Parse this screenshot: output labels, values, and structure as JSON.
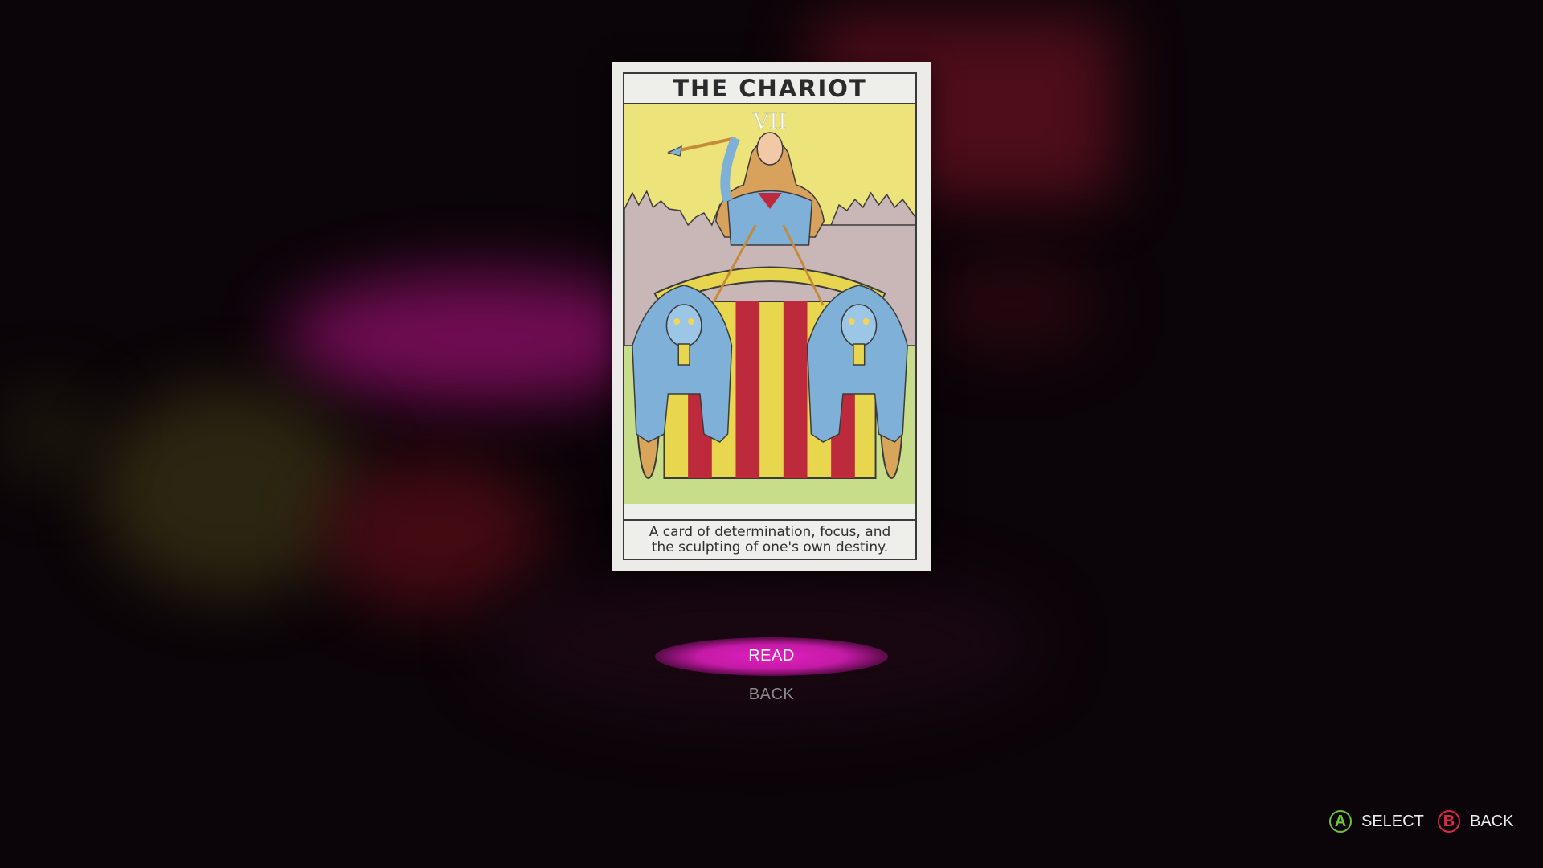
{
  "card": {
    "title": "THE CHARIOT",
    "numeral": "VII",
    "caption_line1": "A card of determination, focus, and",
    "caption_line2": "the sculpting of one's own destiny."
  },
  "menu": {
    "items": [
      {
        "label": "READ",
        "selected": true
      },
      {
        "label": "BACK",
        "selected": false
      }
    ]
  },
  "prompts": {
    "select": {
      "button": "A",
      "label": "SELECT",
      "color": "#6fc13c"
    },
    "back": {
      "button": "B",
      "label": "BACK",
      "color": "#d9294a"
    }
  },
  "colors": {
    "accent": "#d21db4",
    "card_sky": "#ece37a",
    "card_ground": "#c8dd8a",
    "sphinx": "#7fb0d8",
    "chariot_red": "#bc2a3c"
  }
}
